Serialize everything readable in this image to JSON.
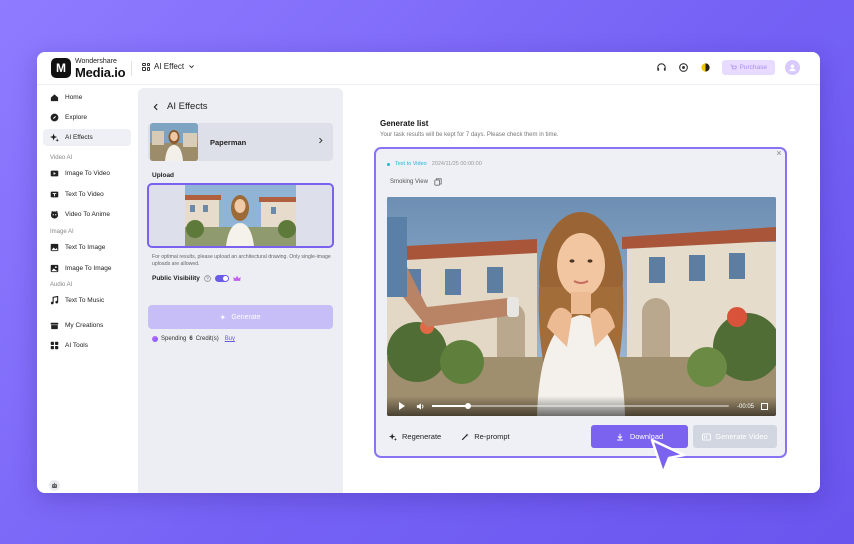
{
  "brand": {
    "small": "Wondershare",
    "name": "Media.io",
    "logo_letter": "M"
  },
  "topbar": {
    "effect_label": "AI Effect",
    "purchase_label": "Purchase"
  },
  "sidebar": {
    "items": [
      {
        "label": "Home",
        "icon": "home-icon"
      },
      {
        "label": "Explore",
        "icon": "compass-icon"
      },
      {
        "label": "AI Effects",
        "icon": "sparkle-icon",
        "active": true
      }
    ],
    "sections": {
      "video_ai": "Video AI",
      "image_ai": "Image AI",
      "audio_ai": "Audio AI"
    },
    "video_items": [
      {
        "label": "Image To Video"
      },
      {
        "label": "Text To Video"
      },
      {
        "label": "Video To Anime"
      }
    ],
    "image_items": [
      {
        "label": "Text To Image"
      },
      {
        "label": "Image To Image"
      }
    ],
    "audio_items": [
      {
        "label": "Text To Music"
      }
    ],
    "bottom_items": [
      {
        "label": "My Creations"
      },
      {
        "label": "AI Tools"
      }
    ]
  },
  "panel": {
    "title": "AI Effects",
    "preset_name": "Paperman",
    "upload_label": "Upload",
    "tip": "For optimal results, please upload an architectural drawing. Only single-image uploads are allowed.",
    "visibility_label": "Public Visibility",
    "visibility_on": true,
    "generate_label": "Generate",
    "spend_prefix": "Spending",
    "spend_count": "6",
    "spend_suffix": "Credit(s)",
    "buy_label": "Buy"
  },
  "generate_list": {
    "title": "Generate list",
    "subtitle": "Your task results will be kept for 7 days. Please check them in time.",
    "task_type": "Text to Video",
    "timestamp": "2024/11/25  00:00:00",
    "preset": "Smoking View",
    "video_time": "-00:05",
    "video_progress": 0.12,
    "regenerate_label": "Regenerate",
    "reprompt_label": "Re-prompt",
    "download_label": "Download",
    "generate_video_label": "Generate Video"
  },
  "colors": {
    "accent": "#7b63f0",
    "tag": "#26b4d8",
    "background": "#7a66f5"
  }
}
